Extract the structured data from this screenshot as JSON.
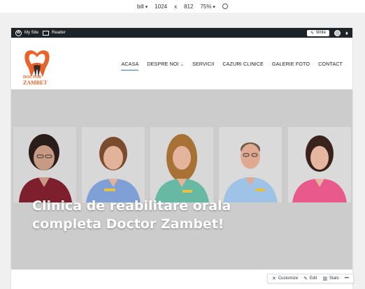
{
  "devtools": {
    "device": "bill",
    "width": "1024",
    "separator": "x",
    "height": "812",
    "zoom": "75%"
  },
  "adminbar": {
    "my_site": "My Site",
    "reader": "Reader",
    "write": "Write"
  },
  "logo": {
    "line1": "DOCTOR",
    "line2": "ZAMBET"
  },
  "nav": {
    "items": [
      "ACASA",
      "DESPRE NOI",
      "SERVICII",
      "CAZURI CLINICE",
      "GALERIE FOTO",
      "CONTACT"
    ],
    "active": "ACASA"
  },
  "hero": {
    "title_line1": "Clinica de reabilitare orala",
    "title_line2": "completa Doctor Zambet!",
    "background": "#cccccc"
  },
  "actions": {
    "customize": "Customize",
    "edit": "Edit",
    "stats": "Stats",
    "more": "•••"
  },
  "colors": {
    "accent": "#3c7bbd",
    "brand": "#e8632b",
    "admin": "#1d2327"
  }
}
